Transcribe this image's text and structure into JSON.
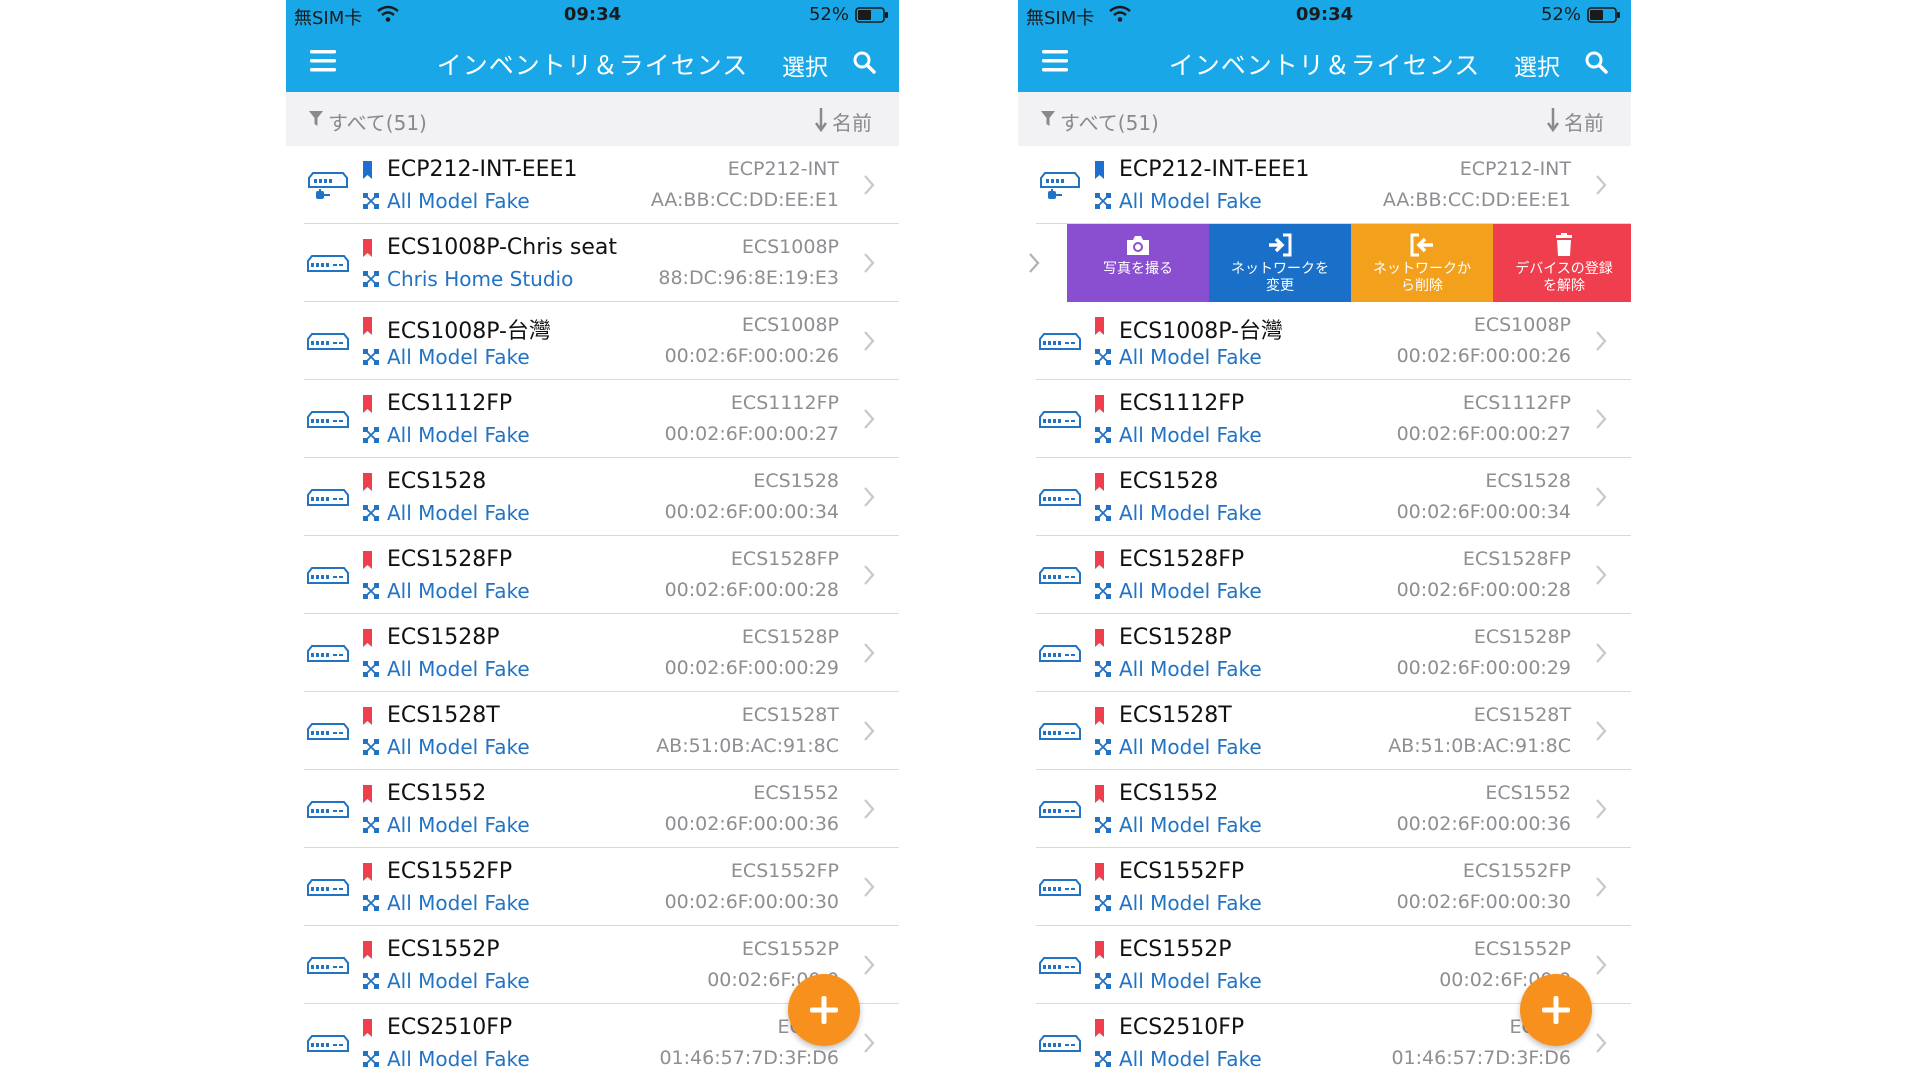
{
  "status": {
    "carrier": "無SIM卡",
    "time": "09:34",
    "battery": "52%"
  },
  "nav": {
    "title": "インベントリ＆ライセンス",
    "select": "選択"
  },
  "filter": {
    "label": "すべて(51)",
    "sort": "名前"
  },
  "colors": {
    "accent": "#1aa7e8",
    "blue_tag": "#1f6fd0",
    "red_tag": "#ef3f4f",
    "fab": "#f7901d"
  },
  "left_list": [
    {
      "name": "ECP212-INT-EEE1",
      "network": "All Model Fake",
      "model": "ECP212-INT",
      "mac": "AA:BB:CC:DD:EE:E1",
      "tag": "blue",
      "icon": "poe-injector-icon"
    },
    {
      "name": "ECS1008P-Chris seat",
      "network": "Chris Home Studio",
      "model": "ECS1008P",
      "mac": "88:DC:96:8E:19:E3",
      "tag": "red",
      "icon": "switch-icon"
    },
    {
      "name": "ECS1008P-台灣",
      "network": "All Model Fake",
      "model": "ECS1008P",
      "mac": "00:02:6F:00:00:26",
      "tag": "red",
      "icon": "switch-icon"
    },
    {
      "name": "ECS1112FP",
      "network": "All Model Fake",
      "model": "ECS1112FP",
      "mac": "00:02:6F:00:00:27",
      "tag": "red",
      "icon": "switch-icon"
    },
    {
      "name": "ECS1528",
      "network": "All Model Fake",
      "model": "ECS1528",
      "mac": "00:02:6F:00:00:34",
      "tag": "red",
      "icon": "switch-icon"
    },
    {
      "name": "ECS1528FP",
      "network": "All Model Fake",
      "model": "ECS1528FP",
      "mac": "00:02:6F:00:00:28",
      "tag": "red",
      "icon": "switch-icon"
    },
    {
      "name": "ECS1528P",
      "network": "All Model Fake",
      "model": "ECS1528P",
      "mac": "00:02:6F:00:00:29",
      "tag": "red",
      "icon": "switch-icon"
    },
    {
      "name": "ECS1528T",
      "network": "All Model Fake",
      "model": "ECS1528T",
      "mac": "AB:51:0B:AC:91:8C",
      "tag": "red",
      "icon": "switch-icon"
    },
    {
      "name": "ECS1552",
      "network": "All Model Fake",
      "model": "ECS1552",
      "mac": "00:02:6F:00:00:36",
      "tag": "red",
      "icon": "switch-icon"
    },
    {
      "name": "ECS1552FP",
      "network": "All Model Fake",
      "model": "ECS1552FP",
      "mac": "00:02:6F:00:00:30",
      "tag": "red",
      "icon": "switch-icon"
    },
    {
      "name": "ECS1552P",
      "network": "All Model Fake",
      "model": "ECS1552P",
      "mac": "00:02:6F:00:0",
      "tag": "red",
      "icon": "switch-icon"
    },
    {
      "name": "ECS2510FP",
      "network": "All Model Fake",
      "model": "ECS25",
      "mac": "01:46:57:7D:3F:D6",
      "tag": "red",
      "icon": "switch-icon"
    }
  ],
  "right_list": [
    {
      "name": "ECP212-INT-EEE1",
      "network": "All Model Fake",
      "model": "ECP212-INT",
      "mac": "AA:BB:CC:DD:EE:E1",
      "tag": "blue",
      "icon": "poe-injector-icon"
    },
    {
      "swipe": true
    },
    {
      "name": "ECS1008P-台灣",
      "network": "All Model Fake",
      "model": "ECS1008P",
      "mac": "00:02:6F:00:00:26",
      "tag": "red",
      "icon": "switch-icon"
    },
    {
      "name": "ECS1112FP",
      "network": "All Model Fake",
      "model": "ECS1112FP",
      "mac": "00:02:6F:00:00:27",
      "tag": "red",
      "icon": "switch-icon"
    },
    {
      "name": "ECS1528",
      "network": "All Model Fake",
      "model": "ECS1528",
      "mac": "00:02:6F:00:00:34",
      "tag": "red",
      "icon": "switch-icon"
    },
    {
      "name": "ECS1528FP",
      "network": "All Model Fake",
      "model": "ECS1528FP",
      "mac": "00:02:6F:00:00:28",
      "tag": "red",
      "icon": "switch-icon"
    },
    {
      "name": "ECS1528P",
      "network": "All Model Fake",
      "model": "ECS1528P",
      "mac": "00:02:6F:00:00:29",
      "tag": "red",
      "icon": "switch-icon"
    },
    {
      "name": "ECS1528T",
      "network": "All Model Fake",
      "model": "ECS1528T",
      "mac": "AB:51:0B:AC:91:8C",
      "tag": "red",
      "icon": "switch-icon"
    },
    {
      "name": "ECS1552",
      "network": "All Model Fake",
      "model": "ECS1552",
      "mac": "00:02:6F:00:00:36",
      "tag": "red",
      "icon": "switch-icon"
    },
    {
      "name": "ECS1552FP",
      "network": "All Model Fake",
      "model": "ECS1552FP",
      "mac": "00:02:6F:00:00:30",
      "tag": "red",
      "icon": "switch-icon"
    },
    {
      "name": "ECS1552P",
      "network": "All Model Fake",
      "model": "ECS1552P",
      "mac": "00:02:6F:00:0",
      "tag": "red",
      "icon": "switch-icon"
    },
    {
      "name": "ECS2510FP",
      "network": "All Model Fake",
      "model": "ECS25",
      "mac": "01:46:57:7D:3F:D6",
      "tag": "red",
      "icon": "switch-icon"
    }
  ],
  "swipe_actions": {
    "photo": "写真を撮る",
    "change_line1": "ネットワークを",
    "change_line2": "変更",
    "remove_line1": "ネットワークか",
    "remove_line2": "ら削除",
    "unregister_line1": "デバイスの登録",
    "unregister_line2": "を解除"
  }
}
